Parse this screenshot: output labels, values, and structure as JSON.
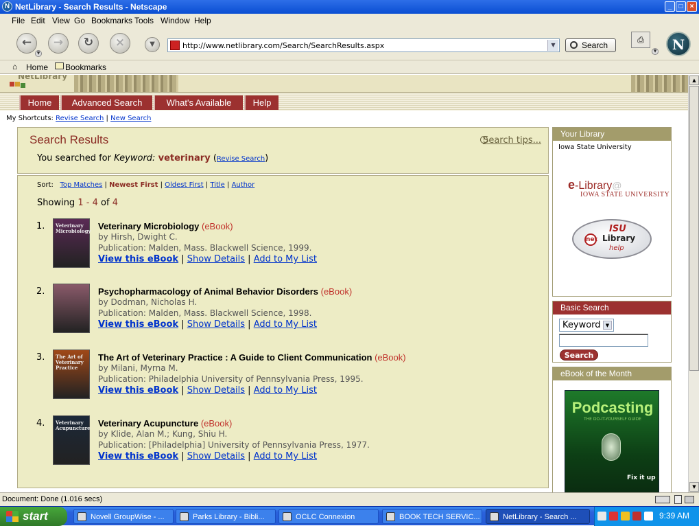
{
  "window": {
    "title": "NetLibrary - Search Results - Netscape",
    "minimize": "_",
    "maximize": "□",
    "close": "×"
  },
  "menu": [
    "File",
    "Edit",
    "View",
    "Go",
    "Bookmarks",
    "Tools",
    "Window",
    "Help"
  ],
  "toolbar": {
    "url": "http://www.netlibrary.com/Search/SearchResults.aspx",
    "search_label": "Search"
  },
  "bookmarks_bar": {
    "home": "Home",
    "bookmarks": "Bookmarks"
  },
  "site": {
    "logo_text": "NetLibrary",
    "nav_tabs": [
      "Home",
      "Advanced Search",
      "What's Available",
      "Help"
    ],
    "shortcuts_label": "My Shortcuts:",
    "shortcut_revise": "Revise Search",
    "shortcut_sep": "|",
    "shortcut_new": "New Search"
  },
  "results_header": {
    "title": "Search Results",
    "tips": "Search tips...",
    "searched_prefix": "You searched for",
    "keyword_label": "Keyword:",
    "term": "veterinary",
    "revise_link": "Revise Search"
  },
  "sort": {
    "label": "Sort:",
    "options": [
      "Top Matches",
      "Newest First",
      "Oldest First",
      "Title",
      "Author"
    ],
    "active": "Newest First"
  },
  "showing": {
    "prefix": "Showing",
    "from": "1",
    "dash": "-",
    "to": "4",
    "of_word": "of",
    "total": "4"
  },
  "results": [
    {
      "num": "1.",
      "title": "Veterinary Microbiology",
      "type": "(eBook)",
      "by": "by Hirsh, Dwight C.",
      "pub": "Publication: Malden, Mass. Blackwell Science, 1999.",
      "thumb_text": "Veterinary Microbiology",
      "cover_color": "#5a2a55"
    },
    {
      "num": "2.",
      "title": "Psychopharmacology of Animal Behavior Disorders",
      "type": "(eBook)",
      "by": "by Dodman, Nicholas H.",
      "pub": "Publication: Malden, Mass. Blackwell Science, 1998.",
      "thumb_text": "",
      "cover_color": "#8a5a6a"
    },
    {
      "num": "3.",
      "title": "The Art of Veterinary Practice : A Guide to Client Communication",
      "type": "(eBook)",
      "by": "by Milani, Myrna M.",
      "pub": "Publication: Philadelphia University of Pennsylvania Press, 1995.",
      "thumb_text": "The Art of Veterinary Practice",
      "cover_color": "#a04818"
    },
    {
      "num": "4.",
      "title": "Veterinary Acupuncture",
      "type": "(eBook)",
      "by": "by Klide, Alan M.; Kung, Shiu H.",
      "pub": "Publication: [Philadelphia] University of Pennsylvania Press, 1977.",
      "thumb_text": "Veterinary Acupuncture",
      "cover_color": "#1c2838"
    }
  ],
  "result_links": {
    "view": "View this eBook",
    "details": "Show Details",
    "add": "Add to My List",
    "sep": "|"
  },
  "sidebar": {
    "your_library": {
      "title": "Your Library",
      "institution": "Iowa State University",
      "elib_e": "e",
      "elib_rest": "-Library",
      "elib_at": "@",
      "elib_inst": "IOWA STATE UNIVERSITY",
      "help_isu": "ISU",
      "help_net": "net",
      "help_library": "Library",
      "help_word": "help"
    },
    "basic_search": {
      "title": "Basic Search",
      "select_value": "Keyword",
      "input_value": "",
      "button": "Search"
    },
    "ebook_month": {
      "title": "eBook of the Month",
      "cover_title": "Podcasting",
      "cover_sub": "THE DO-IT-YOURSELF GUIDE",
      "cover_fix": "Fix it up"
    }
  },
  "status": {
    "text": "Document: Done (1.016 secs)"
  },
  "taskbar": {
    "start": "start",
    "tasks": [
      {
        "label": "Novell GroupWise - ...",
        "active": false
      },
      {
        "label": "Parks Library - Bibli...",
        "active": false
      },
      {
        "label": "OCLC Connexion",
        "active": false
      },
      {
        "label": "BOOK TECH SERVIC...",
        "active": false
      },
      {
        "label": "NetLibrary - Search ...",
        "active": true
      }
    ],
    "clock": "9:39 AM"
  }
}
